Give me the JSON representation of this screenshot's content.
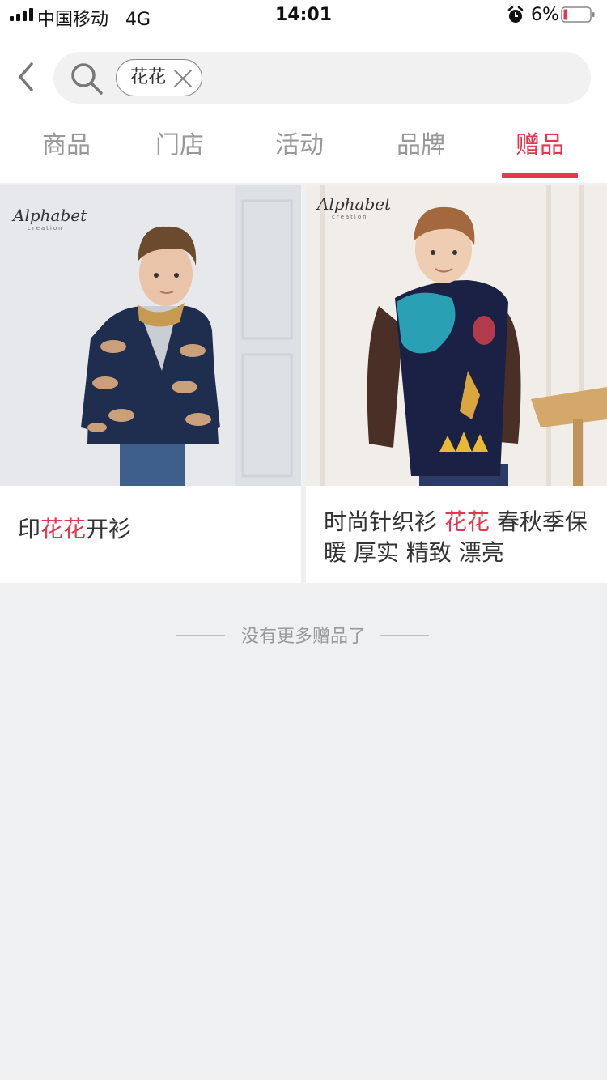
{
  "status_bar": {
    "carrier": "中国移动",
    "network": "4G",
    "time": "14:01",
    "battery": "6%",
    "icons": [
      "signal-icon",
      "alarm-icon",
      "battery-icon"
    ]
  },
  "header": {
    "back_icon": "chevron-left-icon",
    "search": {
      "icon": "search-icon",
      "tag": "花花",
      "tag_remove_icon": "close-icon"
    }
  },
  "tabs": [
    {
      "label": "商品",
      "active": false
    },
    {
      "label": "门店",
      "active": false
    },
    {
      "label": "活动",
      "active": false
    },
    {
      "label": "品牌",
      "active": false
    },
    {
      "label": "赠品",
      "active": true
    }
  ],
  "products": [
    {
      "brand": "Alphabet",
      "brand_sub": "creation",
      "title_before": "印",
      "title_highlight": "花花",
      "title_after": "开衫"
    },
    {
      "brand": "Alphabet",
      "brand_sub": "creation",
      "title_before": "时尚针织衫 ",
      "title_highlight": "花花",
      "title_after": " 春秋季保暖 厚实 精致 漂亮"
    }
  ],
  "end_note": "没有更多赠品了",
  "colors": {
    "accent": "#e8344e",
    "background": "#eff0f2",
    "tab_inactive": "#999999"
  }
}
